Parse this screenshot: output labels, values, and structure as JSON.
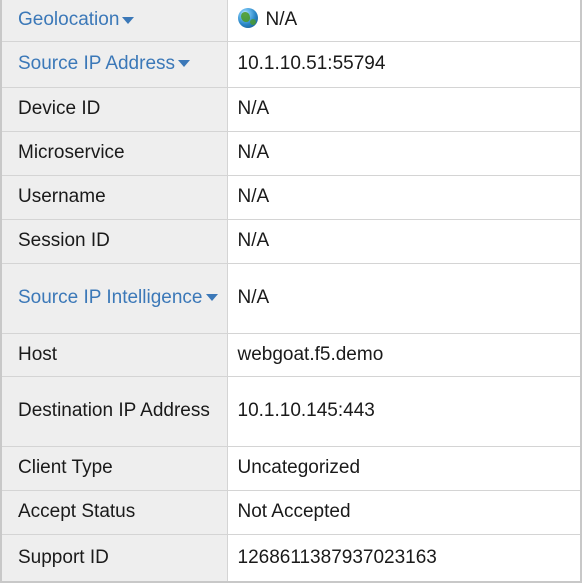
{
  "colors": {
    "link": "#3b78b8",
    "label_bg": "#eeeeee",
    "border": "#d4d4d4"
  },
  "rows": [
    {
      "label": "Geolocation",
      "value": "N/A",
      "label_is_link": true,
      "value_icon": "globe-icon"
    },
    {
      "label": "Source IP Address",
      "value": "10.1.10.51:55794",
      "label_is_link": true
    },
    {
      "label": "Device ID",
      "value": "N/A"
    },
    {
      "label": "Microservice",
      "value": "N/A"
    },
    {
      "label": "Username",
      "value": "N/A"
    },
    {
      "label": "Session ID",
      "value": "N/A"
    },
    {
      "label": "Source IP Intelligence",
      "value": "N/A",
      "label_is_link": true
    },
    {
      "label": "Host",
      "value": "webgoat.f5.demo"
    },
    {
      "label": "Destination IP Address",
      "value": "10.1.10.145:443"
    },
    {
      "label": "Client Type",
      "value": "Uncategorized"
    },
    {
      "label": "Accept Status",
      "value": "Not Accepted"
    },
    {
      "label": "Support ID",
      "value": "1268611387937023163"
    }
  ]
}
